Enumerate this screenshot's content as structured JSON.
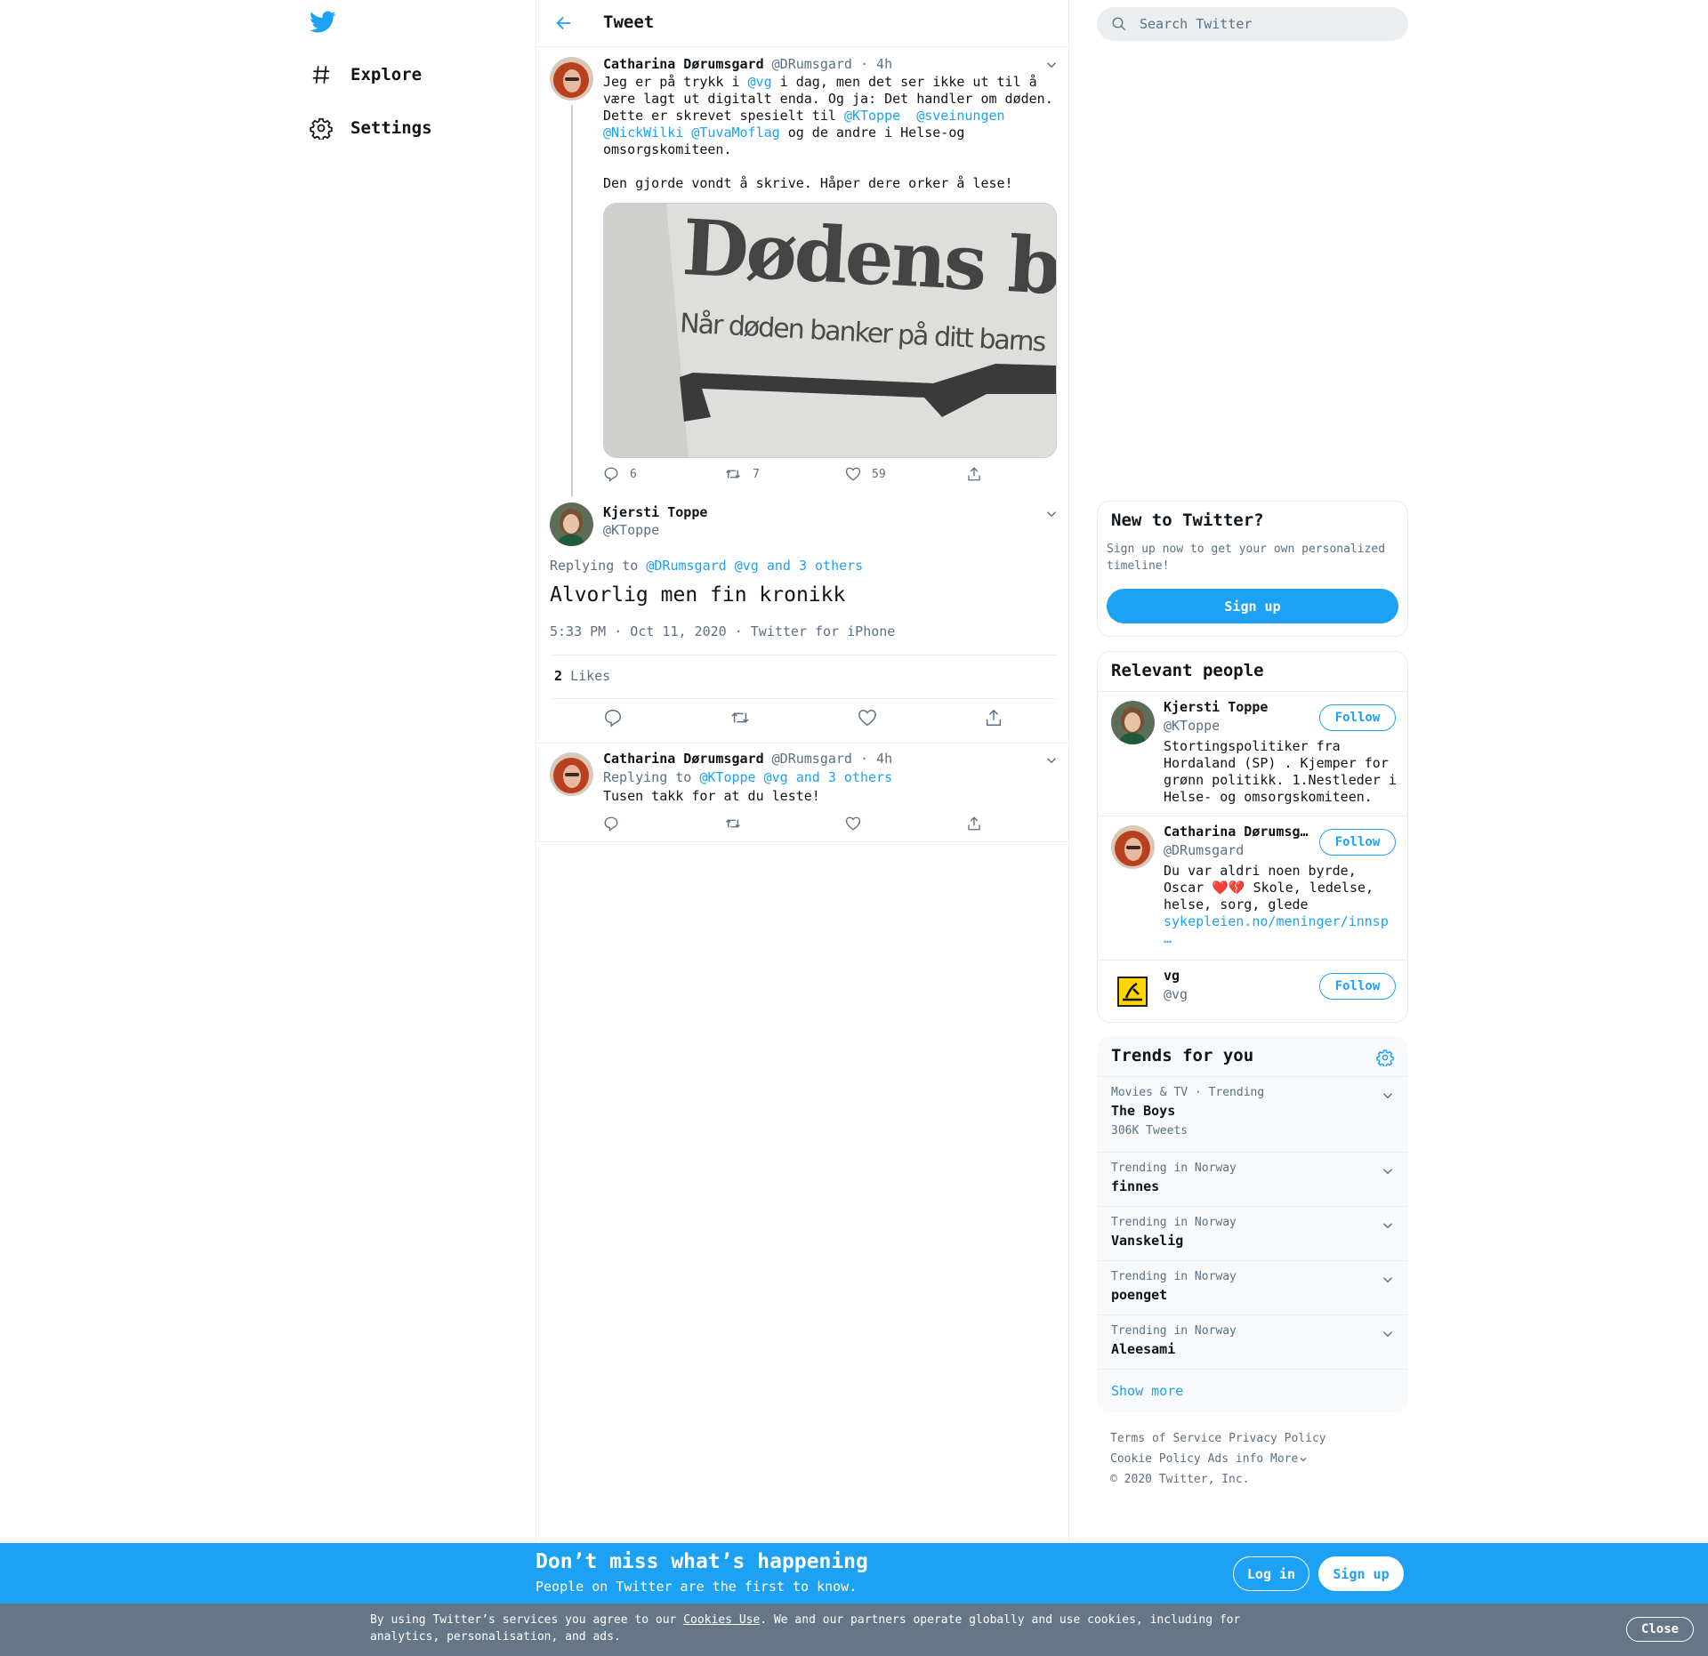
{
  "nav": {
    "items": [
      {
        "label": "Explore",
        "icon": "hashtag-icon"
      },
      {
        "label": "Settings",
        "icon": "gear-icon"
      }
    ]
  },
  "header": {
    "title": "Tweet"
  },
  "tweet1": {
    "name": "Catharina Dørumsgard",
    "handle": "@DRumsgard",
    "time": "· 4h",
    "text_parts": [
      "Jeg er på trykk i ",
      "@vg",
      " i dag, men det ser ikke ut til å\nvære lagt ut digitalt enda. Og ja: Det handler om døden.\nDette er skrevet spesielt til ",
      "@KToppe",
      "  ",
      "@sveinungen",
      "\n",
      "@NickWilki",
      " ",
      "@TuvaMoflag",
      " og de andre i Helse-og\nomsorgskomiteen.\n\nDen gjorde vondt å skrive. Håper dere orker å lese!"
    ],
    "image_title": "Dødens b",
    "image_subtitle": "Når døden banker på ditt barns",
    "replies": "6",
    "retweets": "7",
    "likes": "59"
  },
  "focus": {
    "name": "Kjersti Toppe",
    "handle": "@KToppe",
    "replying_label": "Replying to ",
    "replying_to": "@DRumsgard @vg and 3 others",
    "text": "Alvorlig men fin kronikk",
    "time": "5:33 PM · Oct 11, 2020",
    "sep": "·",
    "source": "Twitter for iPhone",
    "likes_count": "2",
    "likes_label": "Likes"
  },
  "reply": {
    "name": "Catharina Dørumsgard",
    "handle": "@DRumsgard",
    "time": "· 4h",
    "replying_label": "Replying to ",
    "replying_to": "@KToppe @vg and 3 others",
    "text": "Tusen takk for at du leste!"
  },
  "search": {
    "placeholder": "Search Twitter"
  },
  "new_to_twitter": {
    "title": "New to Twitter?",
    "text": "Sign up now to get your own personalized timeline!",
    "button": "Sign up"
  },
  "relevant": {
    "title": "Relevant people",
    "follow": "Follow",
    "people": [
      {
        "name": "Kjersti Toppe",
        "handle": "@KToppe",
        "bio": "Stortingspolitiker fra Hordaland (SP) . Kjemper for grønn politikk. 1.Nestleder i Helse- og omsorgskomiteen."
      },
      {
        "name": "Catharina Dørumsg…",
        "handle": "@DRumsgard",
        "bio_before": "Du var aldri noen byrde, Oscar ",
        "emoji": "❤️💔",
        "bio_after": " Skole, ledelse, helse, sorg, glede",
        "link": "sykepleien.no/meninger/innsp",
        "link_ellipsis": "…"
      },
      {
        "name": "vg",
        "handle": "@vg"
      }
    ]
  },
  "trends": {
    "title": "Trends for you",
    "items": [
      {
        "meta": "Movies & TV · Trending",
        "name": "The Boys",
        "count": "306K Tweets"
      },
      {
        "meta": "Trending in Norway",
        "name": "finnes"
      },
      {
        "meta": "Trending in Norway",
        "name": "Vanskelig"
      },
      {
        "meta": "Trending in Norway",
        "name": "poenget"
      },
      {
        "meta": "Trending in Norway",
        "name": "Aleesami"
      }
    ],
    "show_more": "Show more"
  },
  "footer": {
    "links": [
      "Terms of Service",
      "Privacy Policy",
      "Cookie Policy",
      "Ads info",
      "More"
    ],
    "copyright": "© 2020 Twitter, Inc."
  },
  "banner": {
    "title": "Don’t miss what’s happening",
    "subtitle": "People on Twitter are the first to know.",
    "login": "Log in",
    "signup": "Sign up"
  },
  "cookie": {
    "text_before": "By using Twitter’s services you agree to our ",
    "link": "Cookies Use",
    "text_after": ". We and our partners operate globally and use cookies, including for analytics, personalisation, and ads.",
    "close": "Close"
  },
  "colors": {
    "accent": "#1da1f2",
    "secondary_text": "#5b7083",
    "border": "#ebeef0",
    "cookie_bar": "#657786"
  }
}
